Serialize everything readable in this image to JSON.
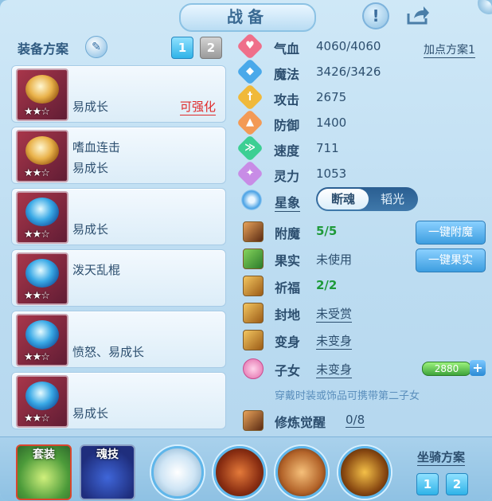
{
  "title": "战备",
  "equip_plan": {
    "label": "装备方案",
    "plan_buttons": [
      "1",
      "2"
    ]
  },
  "equipment": [
    {
      "name": "",
      "sub": "易成长",
      "tag": "可强化",
      "stars": "★★☆"
    },
    {
      "name": "嗜血连击",
      "sub": "易成长",
      "tag": "",
      "stars": "★★☆"
    },
    {
      "name": "",
      "sub": "易成长",
      "tag": "",
      "stars": "★★☆"
    },
    {
      "name": "泼天乱棍",
      "sub": "",
      "tag": "",
      "stars": "★★☆"
    },
    {
      "name": "",
      "sub": "愤怒、易成长",
      "tag": "",
      "stars": "★★☆"
    },
    {
      "name": "",
      "sub": "易成长",
      "tag": "",
      "stars": "★★☆"
    }
  ],
  "add_point_plan": "加点方案1",
  "stats": [
    {
      "label": "气血",
      "value": "4060/4060",
      "icon": "heart-icon",
      "glyph": "♥",
      "color": "#ef6f8a"
    },
    {
      "label": "魔法",
      "value": "3426/3426",
      "icon": "mana-icon",
      "glyph": "◆",
      "color": "#4aa9ea"
    },
    {
      "label": "攻击",
      "value": "2675",
      "icon": "attack-icon",
      "glyph": "†",
      "color": "#f0b93a"
    },
    {
      "label": "防御",
      "value": "1400",
      "icon": "defense-icon",
      "glyph": "▲",
      "color": "#f39a55"
    },
    {
      "label": "速度",
      "value": "711",
      "icon": "speed-icon",
      "glyph": "≫",
      "color": "#3ccf93"
    },
    {
      "label": "灵力",
      "value": "1053",
      "icon": "spirit-power-icon",
      "glyph": "✦",
      "color": "#c88ce6"
    }
  ],
  "star_seal": {
    "label": "星象",
    "active": "断魂",
    "inactive": "韬光"
  },
  "extras": [
    {
      "label": "附魔",
      "value": "5/5",
      "style": "green",
      "icon": "enchant-icon"
    },
    {
      "label": "果实",
      "value": "未使用",
      "style": "plain",
      "icon": "fruit-icon"
    },
    {
      "label": "祈福",
      "value": "2/2",
      "style": "green",
      "icon": "blessing-icon"
    },
    {
      "label": "封地",
      "value": "未受赏",
      "style": "ul",
      "icon": "fief-icon"
    },
    {
      "label": "变身",
      "value": "未变身",
      "style": "ul",
      "icon": "transform-icon"
    },
    {
      "label": "子女",
      "value": "未变身",
      "style": "ul",
      "icon": "child-icon"
    }
  ],
  "buttons": {
    "one_click_enchant": "一键附魔",
    "one_click_fruit": "一键果实"
  },
  "spirit_value": "2880",
  "hint": "穿戴时装或饰品可携带第二子女",
  "cultivation": {
    "label": "修炼觉醒",
    "value": "0/8"
  },
  "bottom": {
    "suit": "套装",
    "soul_skill": "魂技",
    "mount_plan": "坐骑方案",
    "mount_buttons": [
      "1",
      "2"
    ]
  }
}
